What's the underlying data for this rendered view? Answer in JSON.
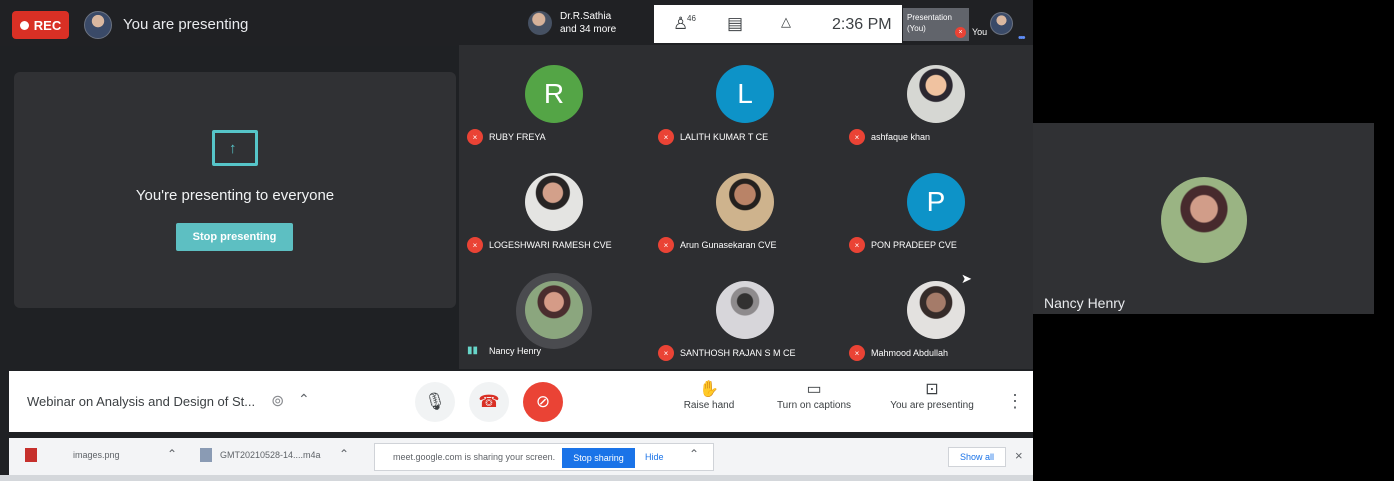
{
  "topbar": {
    "rec_label": "REC",
    "presenting_status": "You are presenting",
    "people_name": "Dr.R.Sathia",
    "people_more": "and 34 more",
    "participant_count": "46",
    "time": "2:36 PM",
    "presentation_label": "Presentation",
    "presentation_owner": "(You)",
    "you_label": "You"
  },
  "share_panel": {
    "message": "You're presenting to everyone",
    "button": "Stop presenting"
  },
  "participants": [
    {
      "initial": "R",
      "name": "RUBY FREYA",
      "color": "#54a546"
    },
    {
      "initial": "L",
      "name": "LALITH KUMAR T CE",
      "color": "#0d93c8"
    },
    {
      "name": "ashfaque khan"
    },
    {
      "name": "LOGESHWARI RAMESH CVE"
    },
    {
      "name": "Arun Gunasekaran CVE"
    },
    {
      "initial": "P",
      "name": "PON PRADEEP CVE",
      "color": "#0d93c8"
    },
    {
      "name": "Nancy Henry"
    },
    {
      "name": "SANTHOSH RAJAN S M CE"
    },
    {
      "name": "Mahmood Abdullah"
    }
  ],
  "right_preview": {
    "name": "Nancy Henry"
  },
  "bottombar": {
    "meeting_title": "Webinar on Analysis and Design of St...",
    "raise_hand": "Raise hand",
    "captions": "Turn on captions",
    "you_are_presenting": "You are presenting"
  },
  "downloads": {
    "file_1": "images.png",
    "file_2": "GMT20210528-14....m4a",
    "sharing_text": "meet.google.com is sharing your screen.",
    "stop_sharing": "Stop sharing",
    "hide": "Hide",
    "show_all": "Show all"
  }
}
